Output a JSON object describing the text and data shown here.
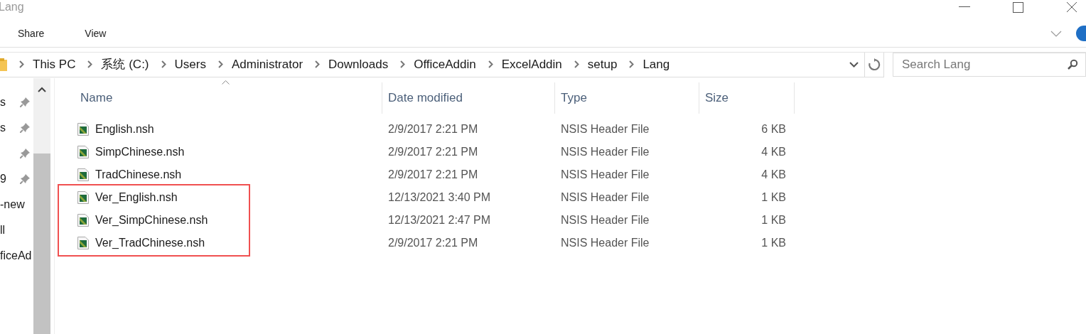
{
  "window": {
    "title": "Lang"
  },
  "ribbon": {
    "tabs": [
      {
        "label": "Share",
        "selected": false
      },
      {
        "label": "View",
        "selected": false
      }
    ]
  },
  "address": {
    "crumbs": [
      "This PC",
      "系统 (C:)",
      "Users",
      "Administrator",
      "Downloads",
      "OfficeAddin",
      "ExcelAddin",
      "setup",
      "Lang"
    ]
  },
  "search": {
    "placeholder": "Search Lang"
  },
  "sidebar": {
    "items": [
      {
        "label": "s",
        "pinned": true
      },
      {
        "label": "s",
        "pinned": true
      },
      {
        "pinned": true
      },
      {
        "label": "9",
        "pinned": true
      },
      {
        "label": "-new",
        "pinned": false
      },
      {
        "label": "ll",
        "pinned": false
      },
      {
        "label": "ficeAd",
        "pinned": false
      }
    ]
  },
  "table": {
    "columns": [
      "Name",
      "Date modified",
      "Type",
      "Size"
    ],
    "rows": [
      {
        "name": "English.nsh",
        "date": "2/9/2017 2:21 PM",
        "type": "NSIS Header File",
        "size": "6 KB",
        "marked": false
      },
      {
        "name": "SimpChinese.nsh",
        "date": "2/9/2017 2:21 PM",
        "type": "NSIS Header File",
        "size": "4 KB",
        "marked": false
      },
      {
        "name": "TradChinese.nsh",
        "date": "2/9/2017 2:21 PM",
        "type": "NSIS Header File",
        "size": "4 KB",
        "marked": false
      },
      {
        "name": "Ver_English.nsh",
        "date": "12/13/2021 3:40 PM",
        "type": "NSIS Header File",
        "size": "1 KB",
        "marked": true
      },
      {
        "name": "Ver_SimpChinese.nsh",
        "date": "12/13/2021 2:47 PM",
        "type": "NSIS Header File",
        "size": "1 KB",
        "marked": true
      },
      {
        "name": "Ver_TradChinese.nsh",
        "date": "2/9/2017 2:21 PM",
        "type": "NSIS Header File",
        "size": "1 KB",
        "marked": true
      }
    ]
  }
}
